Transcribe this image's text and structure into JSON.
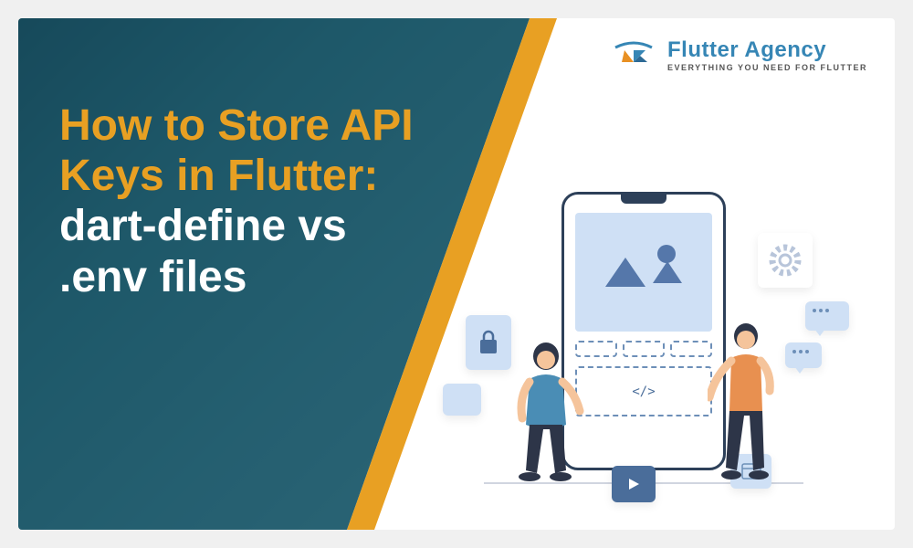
{
  "title": {
    "line1": "How to Store API",
    "line2": "Keys in Flutter:",
    "line3": "dart-define vs",
    "line4": ".env files"
  },
  "logo": {
    "title": "Flutter Agency",
    "tagline": "EVERYTHING YOU NEED FOR FLUTTER"
  },
  "illustration": {
    "code_symbol": "</>"
  },
  "colors": {
    "accent_orange": "#e8a023",
    "brand_blue": "#3686b5",
    "dark_teal": "#1a5a6e"
  }
}
